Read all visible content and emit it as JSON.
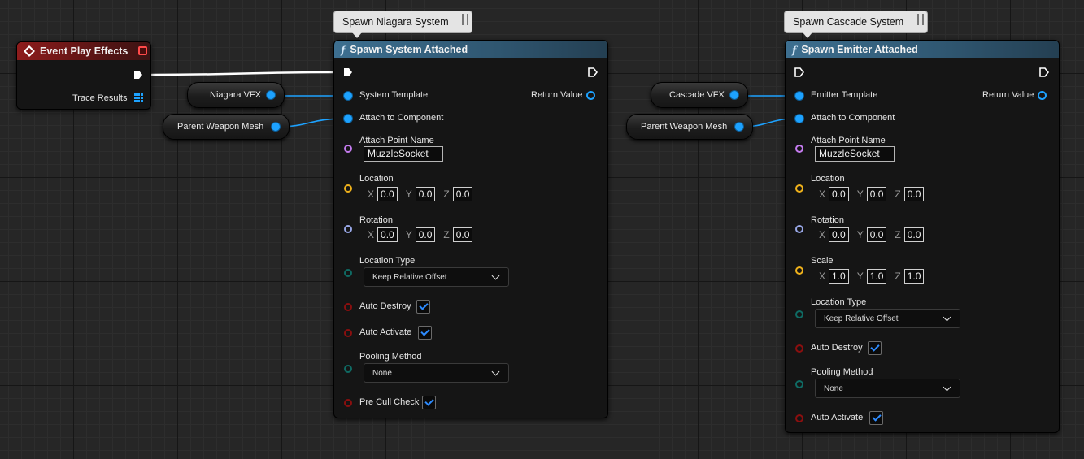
{
  "event_node": {
    "title": "Event Play Effects",
    "trace_results_label": "Trace Results"
  },
  "variables": {
    "niagara_vfx": "Niagara VFX",
    "parent_weapon_mesh_1": "Parent Weapon Mesh",
    "cascade_vfx": "Cascade VFX",
    "parent_weapon_mesh_2": "Parent Weapon Mesh"
  },
  "niagara_node": {
    "comment": "Spawn Niagara System",
    "title": "Spawn System Attached",
    "system_template": "System Template",
    "return_value": "Return Value",
    "attach_to_component": "Attach to Component",
    "attach_point_name": "Attach Point Name",
    "attach_point_value": "MuzzleSocket",
    "location_label": "Location",
    "location": {
      "x": "0.0",
      "y": "0.0",
      "z": "0.0"
    },
    "rotation_label": "Rotation",
    "rotation": {
      "x": "0.0",
      "y": "0.0",
      "z": "0.0"
    },
    "location_type_label": "Location Type",
    "location_type_value": "Keep Relative Offset",
    "auto_destroy": "Auto Destroy",
    "auto_activate": "Auto Activate",
    "pooling_method_label": "Pooling Method",
    "pooling_method_value": "None",
    "pre_cull_check": "Pre Cull Check"
  },
  "cascade_node": {
    "comment": "Spawn Cascade System",
    "title": "Spawn Emitter Attached",
    "emitter_template": "Emitter Template",
    "return_value": "Return Value",
    "attach_to_component": "Attach to Component",
    "attach_point_name": "Attach Point Name",
    "attach_point_value": "MuzzleSocket",
    "location_label": "Location",
    "location": {
      "x": "0.0",
      "y": "0.0",
      "z": "0.0"
    },
    "rotation_label": "Rotation",
    "rotation": {
      "x": "0.0",
      "y": "0.0",
      "z": "0.0"
    },
    "scale_label": "Scale",
    "scale": {
      "x": "1.0",
      "y": "1.0",
      "z": "1.0"
    },
    "location_type_label": "Location Type",
    "location_type_value": "Keep Relative Offset",
    "auto_destroy": "Auto Destroy",
    "pooling_method_label": "Pooling Method",
    "pooling_method_value": "None",
    "auto_activate": "Auto Activate"
  },
  "axis_labels": {
    "x": "X",
    "y": "Y",
    "z": "Z"
  },
  "colors": {
    "exec_pin": "#ffffff",
    "object_pin": "#1da2ff",
    "name_pin": "#c57cf0",
    "vector_pin": "#f0b21b",
    "rotator_pin": "#99a8e8",
    "enum_pin": "#0f6b64",
    "bool_pin": "#8b0f0f",
    "event_header": "#8e1c1c",
    "function_header": "#3d6f90"
  }
}
